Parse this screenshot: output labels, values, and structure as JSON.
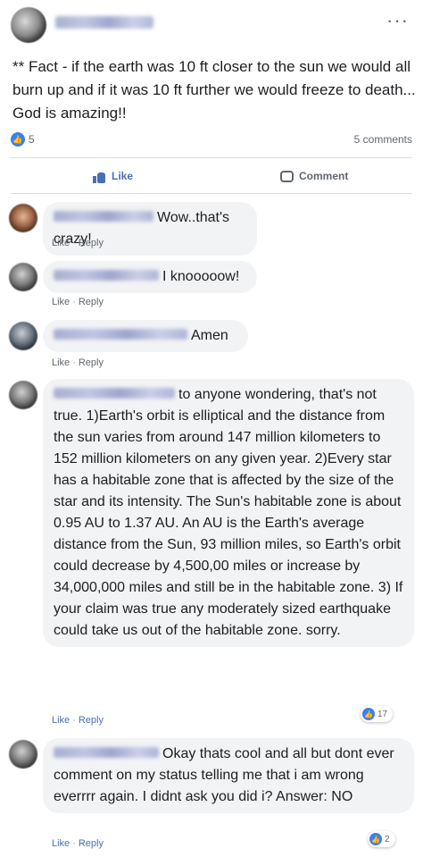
{
  "post": {
    "author_name": "Marija Pranic",
    "more_icon": "ellipsis-icon",
    "text": "** Fact - if the earth was 10 ft closer to the sun we would all burn up and if it was 10 ft further we would freeze to death... God is amazing!!",
    "reactions_count": "5",
    "comments_count": "5 comments",
    "like_label": "Like",
    "comment_label": "Comment"
  },
  "comments": [
    {
      "author": "John Brown",
      "text": "Wow..that's crazy!",
      "like_label": "Like",
      "reply_label": "Reply"
    },
    {
      "author": "Marija Pranic",
      "text": "I knooooow!",
      "like_label": "Like",
      "reply_label": "Reply"
    },
    {
      "author": "Casper Lukerson",
      "text": "Amen",
      "like_label": "Like",
      "reply_label": "Reply"
    },
    {
      "author": "Nomad Parker",
      "text": "to anyone wondering, that's not true. 1)Earth's orbit is elliptical and the distance from the sun varies from around 147 million kilometers to 152 million kilometers on any given year. 2)Every star has a habitable zone that is affected by the size of the star and its intensity. The Sun's habitable zone is about 0.95 AU to 1.37 AU. An AU is the Earth's average distance from the Sun, 93 million miles, so Earth's orbit could decrease by 4,500,00 miles or increase by 34,000,000 miles and still be in the habitable zone. 3) If your claim was true any moderately sized earthquake could take us out of the habitable zone. sorry.",
      "like_label": "Like",
      "reply_label": "Reply",
      "reactions": "17"
    },
    {
      "author": "Marija Pranic",
      "text": "Okay thats cool and all but dont ever comment on my status telling me that i am wrong everrrr again. I didnt ask you did i? Answer: NO",
      "like_label": "Like",
      "reply_label": "Reply",
      "reactions": "2"
    }
  ],
  "colors": {
    "like_blue": "#3b7ff1",
    "bubble_bg": "#f2f3f5",
    "meta_gray": "#606770"
  }
}
